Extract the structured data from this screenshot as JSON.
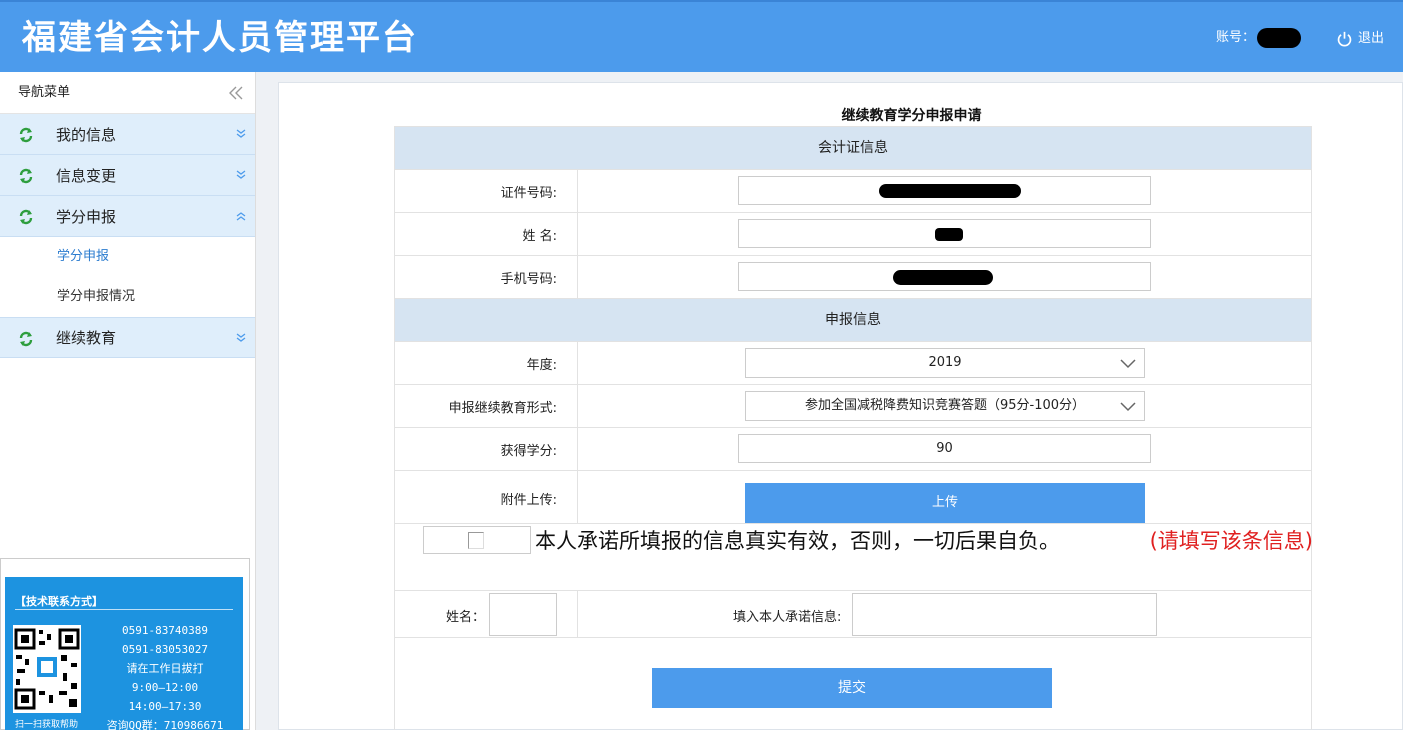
{
  "header": {
    "title": "福建省会计人员管理平台",
    "account_label": "账号：",
    "logout_label": "退出"
  },
  "sidebar": {
    "title": "导航菜单",
    "groups": [
      {
        "label": "我的信息"
      },
      {
        "label": "信息变更"
      },
      {
        "label": "学分申报",
        "items": [
          {
            "label": "学分申报"
          },
          {
            "label": "学分申报情况"
          }
        ]
      },
      {
        "label": "继续教育"
      }
    ]
  },
  "contact": {
    "title": "【技术联系方式】",
    "phone1": "0591-83740389",
    "phone2": "0591-83053027",
    "line3": "请在工作日拔打",
    "hours1": "9:00—12:00",
    "hours2": "14:00—17:30",
    "qq": "咨询QQ群：710986671",
    "qr_caption": "扫一扫获取帮助"
  },
  "form": {
    "title": "继续教育学分申报申请",
    "section1": "会计证信息",
    "id_label": "证件号码:",
    "name_label": "姓 名:",
    "phone_label": "手机号码:",
    "section2": "申报信息",
    "year_label": "年度:",
    "year_value": "2019",
    "form_label": "申报继续教育形式:",
    "form_value": "参加全国减税降费知识竞赛答题（95分-100分）",
    "credit_label": "获得学分:",
    "credit_value": "90",
    "attach_label": "附件上传:",
    "upload_label": "上传",
    "commit_text": "本人承诺所填报的信息真实有效，否则，一切后果自负。",
    "commit_warning": "(请填写该条信息)",
    "sign_name_label": "姓名：",
    "sign_promise_label": "填入本人承诺信息:",
    "submit_label": "提交"
  },
  "colors": {
    "header": "#4c9bec",
    "nav_group": "#dfeefb",
    "section_head": "#d6e4f2",
    "warning": "#e02020"
  }
}
